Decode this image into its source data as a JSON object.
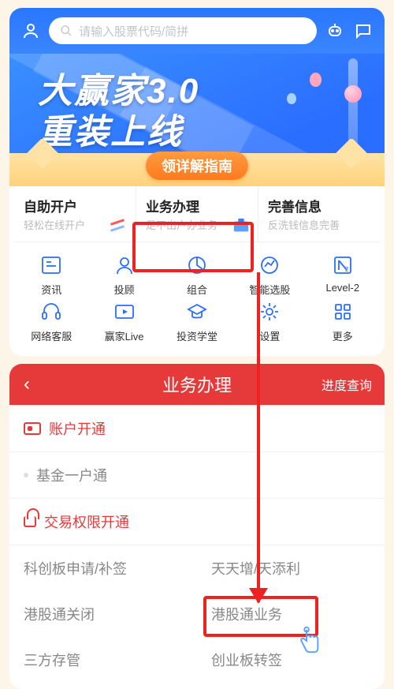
{
  "header": {
    "search_placeholder": "请输入股票代码/简拼"
  },
  "banner": {
    "line1": "大赢家3.0",
    "line2": "重装上线",
    "guide_button": "领详解指南"
  },
  "services": [
    {
      "title": "自助开户",
      "subtitle": "轻松在线开户"
    },
    {
      "title": "业务办理",
      "subtitle": "足不出户办业务"
    },
    {
      "title": "完善信息",
      "subtitle": "反洗钱信息完善"
    }
  ],
  "grid": {
    "row1": [
      {
        "label": "资讯",
        "icon": "news-icon"
      },
      {
        "label": "投顾",
        "icon": "advisor-icon"
      },
      {
        "label": "组合",
        "icon": "portfolio-icon"
      },
      {
        "label": "智能选股",
        "icon": "stockpick-icon"
      },
      {
        "label": "Level-2",
        "icon": "level2-icon"
      }
    ],
    "row2": [
      {
        "label": "网络客服",
        "icon": "support-icon"
      },
      {
        "label": "赢家Live",
        "icon": "live-icon"
      },
      {
        "label": "投资学堂",
        "icon": "school-icon"
      },
      {
        "label": "设置",
        "icon": "settings-icon"
      },
      {
        "label": "更多",
        "icon": "more-icon"
      }
    ]
  },
  "business": {
    "title": "业务办理",
    "progress_link": "进度查询",
    "sections": [
      {
        "header": "账户开通",
        "items": [
          "基金一户通"
        ]
      },
      {
        "header": "交易权限开通",
        "items_pairs": [
          [
            "科创板申请/补签",
            "天天增/天添利"
          ],
          [
            "港股通关闭",
            "港股通业务"
          ],
          [
            "三方存管",
            "创业板转签"
          ]
        ]
      }
    ]
  }
}
